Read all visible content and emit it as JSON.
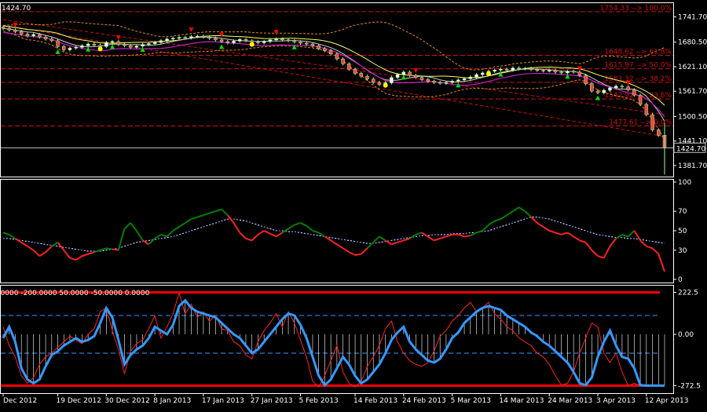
{
  "colors": {
    "background": "#000000",
    "frame": "#ffffff",
    "grid": "#6f6f6f",
    "axis_text": "#ffffff",
    "fib": "#d01010",
    "bull_candle": "#ffffff",
    "bear_candle": "#ff4040",
    "candle_outline": "#9aff9a",
    "bb_band": "#e08a10",
    "ma_fast": "#c8c8c8",
    "ma_slow": "#ffff66",
    "ma_purple": "#c020c0",
    "dot": "#ffff00",
    "arrow_up": "#00e000",
    "arrow_down": "#ff0000",
    "rsi_bull": "#008000",
    "rsi_bear": "#ff2020",
    "rsi_signal": "#ffffff",
    "rsi_signal2": "#1030ff",
    "cci_main": "#3399ff",
    "cci_fast": "#ff2020",
    "cci_hist": "#ffffff",
    "cci_level": "#3399ff",
    "cci_extreme": "#ff0000"
  },
  "chart_data": [
    {
      "type": "line",
      "title": "",
      "current_price_label": "1424.70",
      "top_left_label": "1424.70",
      "ylim": [
        1355,
        1775
      ],
      "y_ticks": [
        "1741.70",
        "1680.50",
        "1621.10",
        "1561.70",
        "1500.50",
        "1441.10",
        "1381.70"
      ],
      "y_tick_values": [
        1741.7,
        1680.5,
        1621.1,
        1561.7,
        1500.5,
        1441.1,
        1381.7
      ],
      "x_ticks": [
        "Dec 2012",
        "19 Dec 2012",
        "30 Dec 2012",
        "8 Jan 2013",
        "17 Jan 2013",
        "27 Jan 2013",
        "5 Feb 2013",
        "14 Feb 2013",
        "24 Feb 2013",
        "5 Mar 2013",
        "14 Mar 2013",
        "24 Mar 2013",
        "3 Apr 2013",
        "12 Apr 2013"
      ],
      "x_tick_index": [
        0,
        9,
        17,
        25,
        33,
        41,
        49,
        58,
        66,
        74,
        82,
        90,
        98,
        106
      ],
      "fib_levels": [
        {
          "label": "1754.33 --> 100.0%",
          "value": 1754.33
        },
        {
          "label": "1648.62 --> 61.8%",
          "value": 1648.62
        },
        {
          "label": "1615.97 --> 50.0%",
          "value": 1615.97
        },
        {
          "label": "1583.32 --> 38.2%",
          "value": 1583.32
        },
        {
          "label": "1542.92 --> 23.6%",
          "value": 1542.92
        },
        {
          "label": "1477.61 --> 0.0%",
          "value": 1477.61
        }
      ],
      "close": [
        1714,
        1710,
        1706,
        1700,
        1696,
        1699,
        1693,
        1688,
        1684,
        1670,
        1662,
        1666,
        1668,
        1672,
        1676,
        1673,
        1670,
        1680,
        1682,
        1675,
        1672,
        1668,
        1671,
        1675,
        1677,
        1680,
        1684,
        1688,
        1690,
        1692,
        1691,
        1694,
        1695,
        1693,
        1690,
        1686,
        1682,
        1679,
        1683,
        1687,
        1684,
        1681,
        1679,
        1682,
        1686,
        1688,
        1686,
        1684,
        1681,
        1678,
        1676,
        1672,
        1665,
        1660,
        1652,
        1640,
        1628,
        1615,
        1605,
        1598,
        1591,
        1583,
        1578,
        1582,
        1595,
        1602,
        1608,
        1600,
        1595,
        1590,
        1586,
        1583,
        1581,
        1583,
        1586,
        1589,
        1592,
        1596,
        1602,
        1606,
        1610,
        1613,
        1615,
        1613,
        1618,
        1616,
        1617,
        1614,
        1612,
        1611,
        1612,
        1608,
        1606,
        1610,
        1608,
        1600,
        1580,
        1562,
        1558,
        1564,
        1570,
        1574,
        1572,
        1565,
        1552,
        1530,
        1505,
        1468,
        1455,
        1424.7
      ]
    },
    {
      "type": "line",
      "title": "",
      "ylim": [
        0,
        100
      ],
      "y_ticks": [
        "100",
        "70",
        "50",
        "30",
        "0"
      ],
      "y_tick_values": [
        100,
        70,
        50,
        30,
        0
      ],
      "series": [
        {
          "values": [
            48,
            46,
            42,
            38,
            34,
            30,
            24,
            28,
            34,
            38,
            30,
            22,
            20,
            24,
            26,
            28,
            30,
            32,
            31,
            30,
            52,
            58,
            50,
            40,
            36,
            42,
            46,
            44,
            50,
            54,
            58,
            62,
            64,
            66,
            68,
            70,
            72,
            66,
            58,
            48,
            42,
            40,
            46,
            50,
            47,
            44,
            48,
            52,
            56,
            58,
            55,
            50,
            48,
            44,
            40,
            36,
            32,
            28,
            25,
            26,
            32,
            38,
            44,
            40,
            36,
            38,
            40,
            42,
            46,
            48,
            44,
            40,
            42,
            44,
            46,
            46,
            44,
            45,
            48,
            50,
            56,
            60,
            62,
            66,
            70,
            74,
            70,
            64,
            58,
            54,
            50,
            48,
            46,
            48,
            44,
            40,
            38,
            30,
            24,
            22,
            34,
            42,
            46,
            44,
            50,
            40,
            34,
            32,
            26,
            8
          ]
        },
        {
          "values": [
            42,
            42,
            41,
            40,
            39,
            38,
            37,
            36,
            35,
            34,
            33,
            32,
            31,
            30,
            29,
            29,
            29,
            30,
            31,
            32,
            34,
            36,
            38,
            39,
            40,
            41,
            42,
            43,
            44,
            46,
            48,
            50,
            52,
            54,
            56,
            58,
            60,
            62,
            62,
            61,
            60,
            58,
            56,
            54,
            52,
            50,
            50,
            49,
            49,
            48,
            47,
            46,
            45,
            44,
            43,
            42,
            41,
            40,
            39,
            38,
            37,
            37,
            38,
            39,
            40,
            41,
            42,
            43,
            44,
            45,
            45,
            46,
            46,
            46,
            47,
            47,
            47,
            48,
            48,
            49,
            50,
            52,
            54,
            56,
            58,
            60,
            62,
            64,
            64,
            63,
            62,
            60,
            58,
            56,
            54,
            52,
            50,
            48,
            46,
            45,
            44,
            43,
            43,
            42,
            42,
            41,
            40,
            39,
            38,
            37
          ]
        }
      ]
    },
    {
      "type": "line",
      "title": "",
      "legend_text": "0.0000 -200.0000 50.0000 -50.0000 0.0000",
      "ylim": [
        -300,
        250
      ],
      "y_ticks": [
        "222.5",
        "0.00",
        "-272.5"
      ],
      "y_tick_values": [
        222.5,
        0,
        -272.5
      ],
      "levels": [
        222.5,
        100,
        -100,
        -272.5
      ],
      "series": [
        {
          "values": [
            -20,
            40,
            -40,
            -180,
            -240,
            -260,
            -240,
            -170,
            -110,
            -90,
            -60,
            -40,
            -20,
            -40,
            -30,
            -10,
            60,
            140,
            90,
            -30,
            -160,
            -110,
            -80,
            -60,
            -20,
            40,
            20,
            0,
            50,
            150,
            180,
            140,
            120,
            110,
            100,
            90,
            60,
            30,
            0,
            -20,
            -60,
            -100,
            -80,
            -40,
            0,
            40,
            80,
            110,
            100,
            50,
            -20,
            -120,
            -220,
            -270,
            -240,
            -180,
            -120,
            -160,
            -220,
            -260,
            -240,
            -200,
            -160,
            -100,
            -30,
            10,
            40,
            -40,
            -80,
            -110,
            -140,
            -150,
            -130,
            -80,
            -20,
            10,
            60,
            90,
            120,
            140,
            150,
            140,
            130,
            100,
            80,
            60,
            40,
            10,
            -10,
            -40,
            -60,
            -90,
            -120,
            -150,
            -200,
            -260,
            -270,
            -230,
            -120,
            -40,
            20,
            -60,
            -120,
            -130,
            -180,
            -270,
            -272.5,
            -272.5,
            -272.5,
            -272.5
          ]
        },
        {
          "values": [
            40,
            -60,
            -120,
            -220,
            -260,
            -230,
            -160,
            -120,
            -100,
            -70,
            -40,
            -10,
            -30,
            -50,
            0,
            30,
            120,
            140,
            20,
            -80,
            -210,
            -90,
            -50,
            -30,
            30,
            100,
            -20,
            40,
            110,
            220,
            110,
            160,
            90,
            120,
            70,
            100,
            30,
            20,
            -40,
            -60,
            -110,
            -130,
            -40,
            20,
            60,
            110,
            40,
            120,
            60,
            -30,
            -120,
            -250,
            -280,
            -220,
            -140,
            -60,
            -200,
            -260,
            -280,
            -250,
            -170,
            -120,
            -60,
            30,
            70,
            -40,
            -100,
            -140,
            -160,
            -170,
            -150,
            -90,
            -10,
            20,
            70,
            100,
            140,
            170,
            120,
            140,
            170,
            110,
            80,
            40,
            20,
            -20,
            -40,
            -60,
            -100,
            -120,
            -160,
            -220,
            -270,
            -260,
            -200,
            -100,
            -20,
            60,
            40,
            -100,
            -150,
            -100,
            -200,
            -272.5,
            -260,
            -272.5,
            -272.5,
            -272.5
          ]
        }
      ]
    }
  ]
}
